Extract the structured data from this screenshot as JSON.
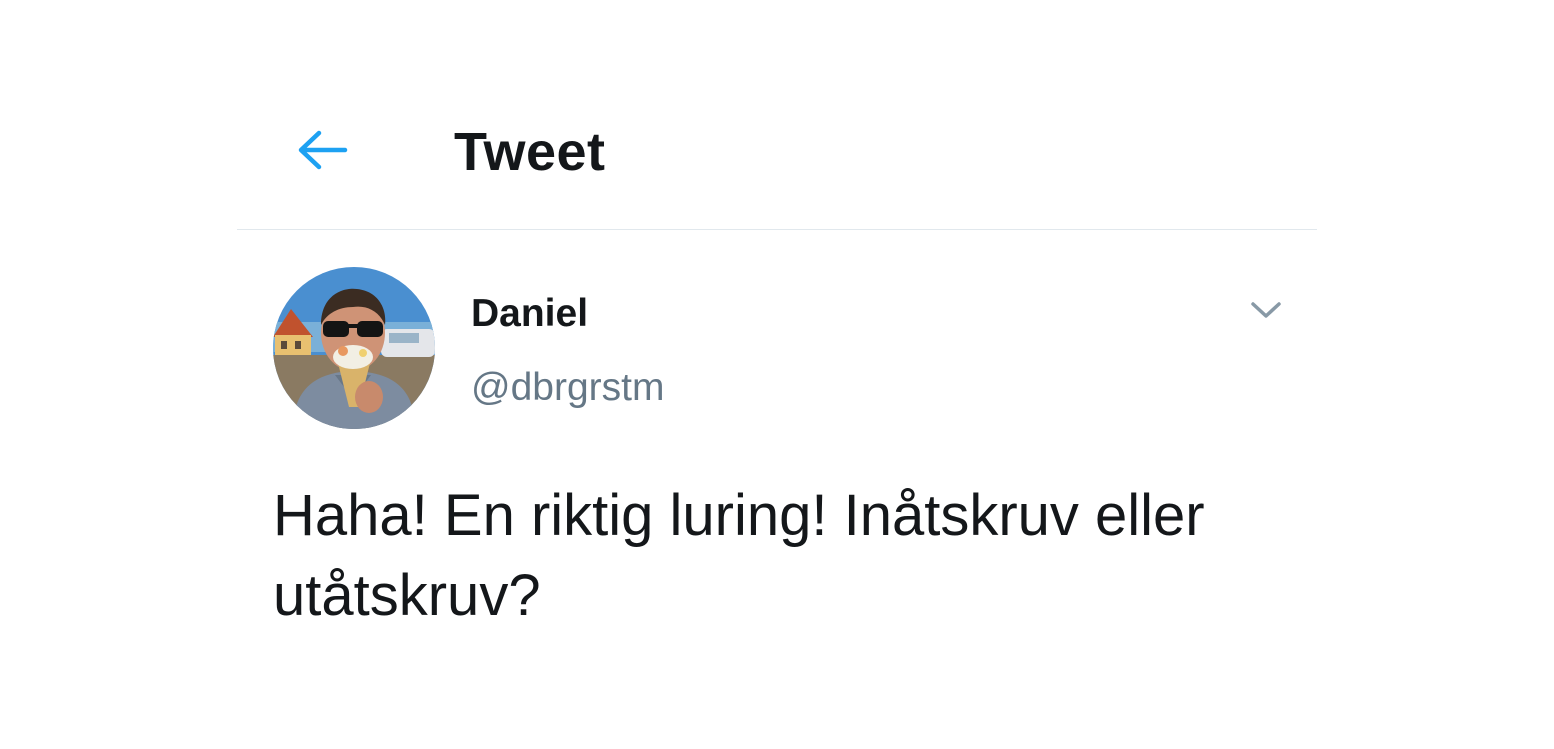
{
  "header": {
    "title": "Tweet",
    "back_icon": "arrow-left-icon",
    "accent_color": "#1da1f2"
  },
  "tweet": {
    "author": {
      "display_name": "Daniel",
      "handle": "@dbrgrstm",
      "avatar_icon": "profile-photo"
    },
    "menu_icon": "chevron-down-icon",
    "text": "Haha! En riktig luring! Inåtskruv eller utåtskruv?"
  },
  "colors": {
    "text_primary": "#14171a",
    "text_secondary": "#657786",
    "divider": "#e1e8ed",
    "chevron": "#8899a6"
  }
}
